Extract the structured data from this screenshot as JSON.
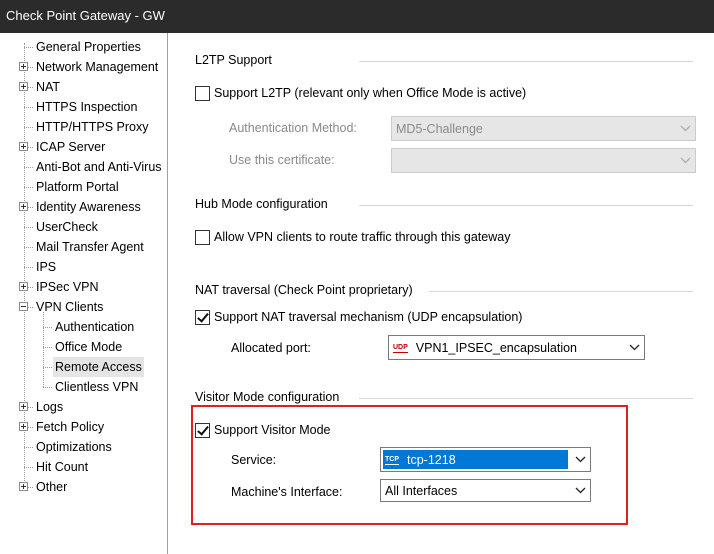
{
  "window": {
    "title": "Check Point Gateway - GW"
  },
  "tree": {
    "items": [
      {
        "label": "General Properties",
        "expander": "",
        "level": 0
      },
      {
        "label": "Network Management",
        "expander": "plus",
        "level": 0
      },
      {
        "label": "NAT",
        "expander": "plus",
        "level": 0
      },
      {
        "label": "HTTPS Inspection",
        "expander": "",
        "level": 0
      },
      {
        "label": "HTTP/HTTPS Proxy",
        "expander": "",
        "level": 0
      },
      {
        "label": "ICAP Server",
        "expander": "plus",
        "level": 0
      },
      {
        "label": "Anti-Bot and Anti-Virus",
        "expander": "",
        "level": 0
      },
      {
        "label": "Platform Portal",
        "expander": "",
        "level": 0
      },
      {
        "label": "Identity Awareness",
        "expander": "plus",
        "level": 0
      },
      {
        "label": "UserCheck",
        "expander": "",
        "level": 0
      },
      {
        "label": "Mail Transfer Agent",
        "expander": "",
        "level": 0
      },
      {
        "label": "IPS",
        "expander": "",
        "level": 0
      },
      {
        "label": "IPSec VPN",
        "expander": "plus",
        "level": 0
      },
      {
        "label": "VPN Clients",
        "expander": "minus",
        "level": 0
      },
      {
        "label": "Authentication",
        "expander": "",
        "level": 1
      },
      {
        "label": "Office Mode",
        "expander": "",
        "level": 1
      },
      {
        "label": "Remote Access",
        "expander": "",
        "level": 1,
        "selected": true
      },
      {
        "label": "Clientless VPN",
        "expander": "",
        "level": 1
      },
      {
        "label": "Logs",
        "expander": "plus",
        "level": 0
      },
      {
        "label": "Fetch Policy",
        "expander": "plus",
        "level": 0
      },
      {
        "label": "Optimizations",
        "expander": "",
        "level": 0
      },
      {
        "label": "Hit Count",
        "expander": "",
        "level": 0
      },
      {
        "label": "Other",
        "expander": "plus",
        "level": 0
      }
    ]
  },
  "l2tp": {
    "title": "L2TP Support",
    "support_label": "Support L2TP (relevant only when Office Mode is active)",
    "support_checked": false,
    "auth_method_label": "Authentication Method:",
    "auth_method_value": "MD5-Challenge",
    "certificate_label": "Use this certificate:",
    "certificate_value": ""
  },
  "hub": {
    "title": "Hub Mode configuration",
    "allow_label": "Allow VPN clients to route traffic through this gateway",
    "allow_checked": false
  },
  "nat_traversal": {
    "title": "NAT traversal (Check Point proprietary)",
    "support_label": "Support NAT traversal mechanism (UDP encapsulation)",
    "support_checked": true,
    "port_label": "Allocated port:",
    "port_icon": "UDP",
    "port_value": "VPN1_IPSEC_encapsulation"
  },
  "visitor": {
    "title": "Visitor Mode configuration",
    "support_label": "Support Visitor Mode",
    "support_checked": true,
    "service_label": "Service:",
    "service_icon": "TCP",
    "service_value": "tcp-1218",
    "interface_label": "Machine's Interface:",
    "interface_value": "All Interfaces"
  },
  "colors": {
    "highlight": "#0078d7",
    "annotation_box": "#e02020",
    "titlebar": "#2b2b2b"
  }
}
